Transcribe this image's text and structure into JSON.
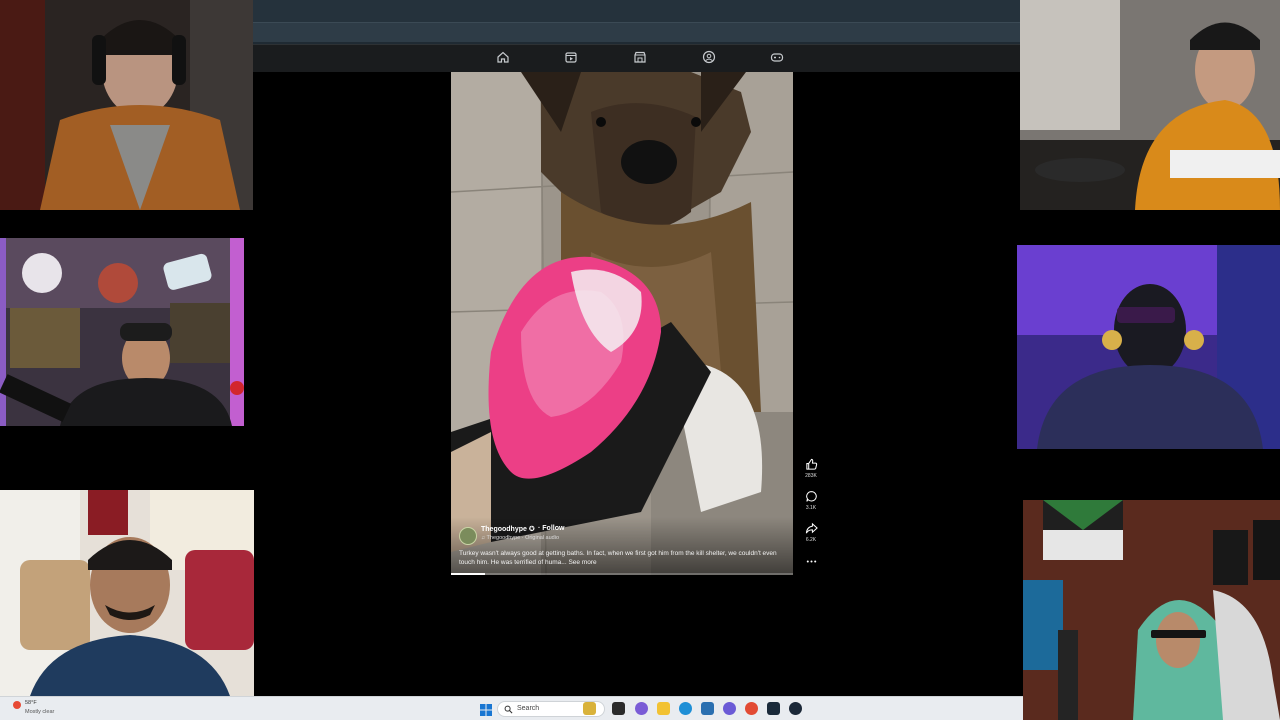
{
  "browser": {
    "nav_icons": [
      "home-icon",
      "video-icon",
      "marketplace-icon",
      "groups-icon",
      "gaming-icon"
    ]
  },
  "reel": {
    "author": "Thegoodhype ✪",
    "follow_label": "· Follow",
    "audio": "♫ Thegoodhype · Original audio",
    "caption": "Turkey wasn't always good at getting baths. In fact, when we first got him from the kill shelter, we couldn't even touch him. He was terrified of huma...",
    "see_more": "See more",
    "progress_percent": 10
  },
  "actions": {
    "like_count": "283K",
    "comment_count": "3.1K",
    "share_count": "6.2K"
  },
  "taskbar": {
    "weather_temp": "58°F",
    "weather_desc": "Mostly clear",
    "search_label": "Search"
  },
  "colors": {
    "accent_pink": "#ec3f86",
    "taskbar_bg": "#e9ecf0",
    "nav_bg": "#1a1c1e"
  }
}
